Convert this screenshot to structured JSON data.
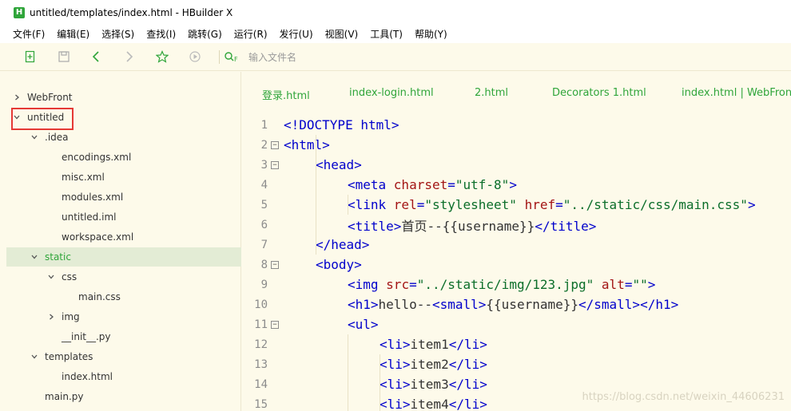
{
  "window": {
    "logo_letter": "H",
    "title": "untitled/templates/index.html - HBuilder X"
  },
  "menu": [
    "文件(F)",
    "编辑(E)",
    "选择(S)",
    "查找(I)",
    "跳转(G)",
    "运行(R)",
    "发行(U)",
    "视图(V)",
    "工具(T)",
    "帮助(Y)"
  ],
  "toolbar": {
    "icons": [
      "new-file-icon",
      "save-icon",
      "back-icon",
      "forward-icon",
      "star-icon",
      "run-icon"
    ],
    "search_placeholder": "输入文件名",
    "accent": "#2fa53a"
  },
  "file_tree": [
    {
      "label": "WebFront",
      "depth": 0,
      "chevron": "right",
      "selected": false
    },
    {
      "label": "untitled",
      "depth": 0,
      "chevron": "down",
      "selected": false,
      "highlighted": true
    },
    {
      "label": ".idea",
      "depth": 1,
      "chevron": "down",
      "selected": false
    },
    {
      "label": "encodings.xml",
      "depth": 2,
      "chevron": "none",
      "selected": false
    },
    {
      "label": "misc.xml",
      "depth": 2,
      "chevron": "none",
      "selected": false
    },
    {
      "label": "modules.xml",
      "depth": 2,
      "chevron": "none",
      "selected": false
    },
    {
      "label": "untitled.iml",
      "depth": 2,
      "chevron": "none",
      "selected": false
    },
    {
      "label": "workspace.xml",
      "depth": 2,
      "chevron": "none",
      "selected": false
    },
    {
      "label": "static",
      "depth": 1,
      "chevron": "down",
      "selected": true
    },
    {
      "label": "css",
      "depth": 2,
      "chevron": "down",
      "selected": false
    },
    {
      "label": "main.css",
      "depth": 3,
      "chevron": "none",
      "selected": false
    },
    {
      "label": "img",
      "depth": 2,
      "chevron": "right",
      "selected": false
    },
    {
      "label": "__init__.py",
      "depth": 2,
      "chevron": "none",
      "selected": false
    },
    {
      "label": "templates",
      "depth": 1,
      "chevron": "down",
      "selected": false
    },
    {
      "label": "index.html",
      "depth": 2,
      "chevron": "none",
      "selected": false
    },
    {
      "label": "main.py",
      "depth": 1,
      "chevron": "none",
      "selected": false
    }
  ],
  "tabs": [
    "登录.html",
    "index-login.html",
    "2.html",
    "Decorators 1.html",
    "index.html | WebFront"
  ],
  "code_lines": [
    {
      "n": "1",
      "fold": false,
      "indent": 0,
      "tokens": [
        [
          "tag",
          "<!DOCTYPE html>"
        ]
      ]
    },
    {
      "n": "2",
      "fold": true,
      "indent": 0,
      "tokens": [
        [
          "tag",
          "<html>"
        ]
      ]
    },
    {
      "n": "3",
      "fold": true,
      "indent": 1,
      "tokens": [
        [
          "tag",
          "<head>"
        ]
      ]
    },
    {
      "n": "4",
      "fold": false,
      "indent": 2,
      "tokens": [
        [
          "tag",
          "<meta "
        ],
        [
          "attr",
          "charset"
        ],
        [
          "tag",
          "="
        ],
        [
          "str",
          "\"utf-8\""
        ],
        [
          "tag",
          ">"
        ]
      ]
    },
    {
      "n": "5",
      "fold": false,
      "indent": 2,
      "tokens": [
        [
          "tag",
          "<link "
        ],
        [
          "attr",
          "rel"
        ],
        [
          "tag",
          "="
        ],
        [
          "str",
          "\"stylesheet\""
        ],
        [
          "tag",
          " "
        ],
        [
          "attr",
          "href"
        ],
        [
          "tag",
          "="
        ],
        [
          "str",
          "\"../static/css/main.css\""
        ],
        [
          "tag",
          ">"
        ]
      ]
    },
    {
      "n": "6",
      "fold": false,
      "indent": 2,
      "tokens": [
        [
          "tag",
          "<title>"
        ],
        [
          "text",
          "首页--{{username}}"
        ],
        [
          "tag",
          "</title>"
        ]
      ]
    },
    {
      "n": "7",
      "fold": false,
      "indent": 1,
      "tokens": [
        [
          "tag",
          "</head>"
        ]
      ]
    },
    {
      "n": "8",
      "fold": true,
      "indent": 1,
      "tokens": [
        [
          "tag",
          "<body>"
        ]
      ]
    },
    {
      "n": "9",
      "fold": false,
      "indent": 2,
      "tokens": [
        [
          "tag",
          "<img "
        ],
        [
          "attr",
          "src"
        ],
        [
          "tag",
          "="
        ],
        [
          "str",
          "\"../static/img/123.jpg\""
        ],
        [
          "tag",
          " "
        ],
        [
          "attr",
          "alt"
        ],
        [
          "tag",
          "="
        ],
        [
          "str",
          "\"\""
        ],
        [
          "tag",
          ">"
        ]
      ]
    },
    {
      "n": "10",
      "fold": false,
      "indent": 2,
      "tokens": [
        [
          "tag",
          "<h1>"
        ],
        [
          "text",
          "hello--"
        ],
        [
          "tag",
          "<small>"
        ],
        [
          "text",
          "{{username}}"
        ],
        [
          "tag",
          "</small></h1>"
        ]
      ]
    },
    {
      "n": "11",
      "fold": true,
      "indent": 2,
      "tokens": [
        [
          "tag",
          "<ul>"
        ]
      ]
    },
    {
      "n": "12",
      "fold": false,
      "indent": 3,
      "tokens": [
        [
          "tag",
          "<li>"
        ],
        [
          "text",
          "item1"
        ],
        [
          "tag",
          "</li>"
        ]
      ]
    },
    {
      "n": "13",
      "fold": false,
      "indent": 3,
      "tokens": [
        [
          "tag",
          "<li>"
        ],
        [
          "text",
          "item2"
        ],
        [
          "tag",
          "</li>"
        ]
      ]
    },
    {
      "n": "14",
      "fold": false,
      "indent": 3,
      "tokens": [
        [
          "tag",
          "<li>"
        ],
        [
          "text",
          "item3"
        ],
        [
          "tag",
          "</li>"
        ]
      ]
    },
    {
      "n": "15",
      "fold": false,
      "indent": 3,
      "tokens": [
        [
          "tag",
          "<li>"
        ],
        [
          "text",
          "item4"
        ],
        [
          "tag",
          "</li>"
        ]
      ]
    }
  ],
  "watermark": "https://blog.csdn.net/weixin_44606231"
}
